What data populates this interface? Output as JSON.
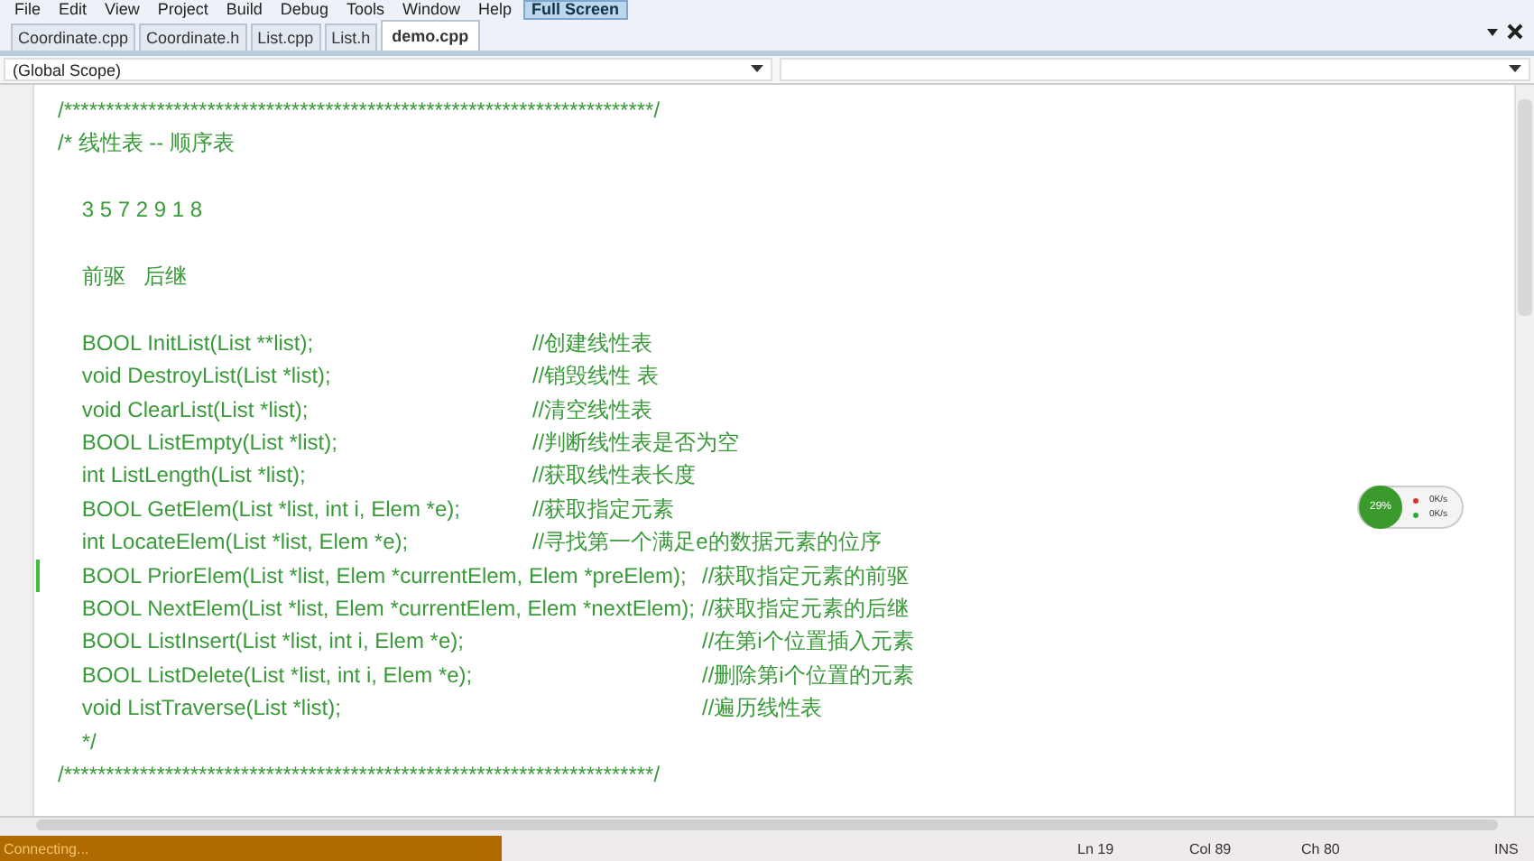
{
  "menu": [
    {
      "label": "File",
      "selected": false
    },
    {
      "label": "Edit",
      "selected": false
    },
    {
      "label": "View",
      "selected": false
    },
    {
      "label": "Project",
      "selected": false
    },
    {
      "label": "Build",
      "selected": false
    },
    {
      "label": "Debug",
      "selected": false
    },
    {
      "label": "Tools",
      "selected": false
    },
    {
      "label": "Window",
      "selected": false
    },
    {
      "label": "Help",
      "selected": false
    },
    {
      "label": "Full Screen",
      "selected": true
    }
  ],
  "tabs": [
    {
      "label": "Coordinate.cpp",
      "selected": false
    },
    {
      "label": "Coordinate.h",
      "selected": false
    },
    {
      "label": "List.cpp",
      "selected": false
    },
    {
      "label": "List.h",
      "selected": false
    },
    {
      "label": "demo.cpp",
      "selected": true
    }
  ],
  "scope": {
    "value": "(Global Scope)"
  },
  "sections": [
    {
      "lines": [
        {
          "code": "/**********************************************************************/",
          "changed": false
        },
        {
          "code": "/* 线性表 -- 顺序表",
          "changed": false
        }
      ]
    },
    {
      "lines": [
        {
          "code": "    3 5 7 2 9 1 8",
          "changed": false
        }
      ]
    },
    {
      "lines": [
        {
          "code": "    前驱   后继",
          "changed": false
        }
      ]
    },
    {
      "lines": [
        {
          "code": "    BOOL InitList(List **list);",
          "comment": "//创建线性表",
          "changed": false
        },
        {
          "code": "    void DestroyList(List *list);",
          "comment": "//销毁线性 表",
          "changed": false
        },
        {
          "code": "    void ClearList(List *list);",
          "comment": "//清空线性表",
          "changed": false
        },
        {
          "code": "    BOOL ListEmpty(List *list);",
          "comment": "//判断线性表是否为空",
          "changed": false
        },
        {
          "code": "    int ListLength(List *list);",
          "comment": "//获取线性表长度",
          "changed": false
        },
        {
          "code": "    BOOL GetElem(List *list, int i, Elem *e);",
          "comment": "//获取指定元素",
          "changed": false
        },
        {
          "code": "    int LocateElem(List *list, Elem *e);",
          "comment": "//寻找第一个满足e的数据元素的位序",
          "changed": false
        }
      ]
    },
    {
      "lines": [
        {
          "code": "    BOOL PriorElem(List *list, Elem *currentElem, Elem *preElem);",
          "comment": "//获取指定元素的前驱",
          "changed": true
        },
        {
          "code": "    BOOL NextElem(List *list, Elem *currentElem, Elem *nextElem);",
          "comment": "//获取指定元素的后继",
          "changed": false
        },
        {
          "code": "    BOOL ListInsert(List *list, int i, Elem *e);",
          "comment": "//在第i个位置插入元素",
          "changed": false
        },
        {
          "code": "    BOOL ListDelete(List *list, int i, Elem *e);",
          "comment": "//删除第i个位置的元素",
          "changed": false
        },
        {
          "code": "    void ListTraverse(List *list);",
          "comment": "//遍历线性表",
          "changed": false
        }
      ]
    },
    {
      "lines": [
        {
          "code": "    */",
          "changed": false
        },
        {
          "code": "/**********************************************************************/",
          "changed": false
        }
      ]
    }
  ],
  "net_widget": {
    "percent": "29%",
    "upload": "0K/s",
    "download": "0K/s"
  },
  "status_bar": {
    "message": "Connecting...",
    "line": "Ln 19",
    "col": "Col 89",
    "ch": "Ch 80",
    "mode": "INS"
  }
}
